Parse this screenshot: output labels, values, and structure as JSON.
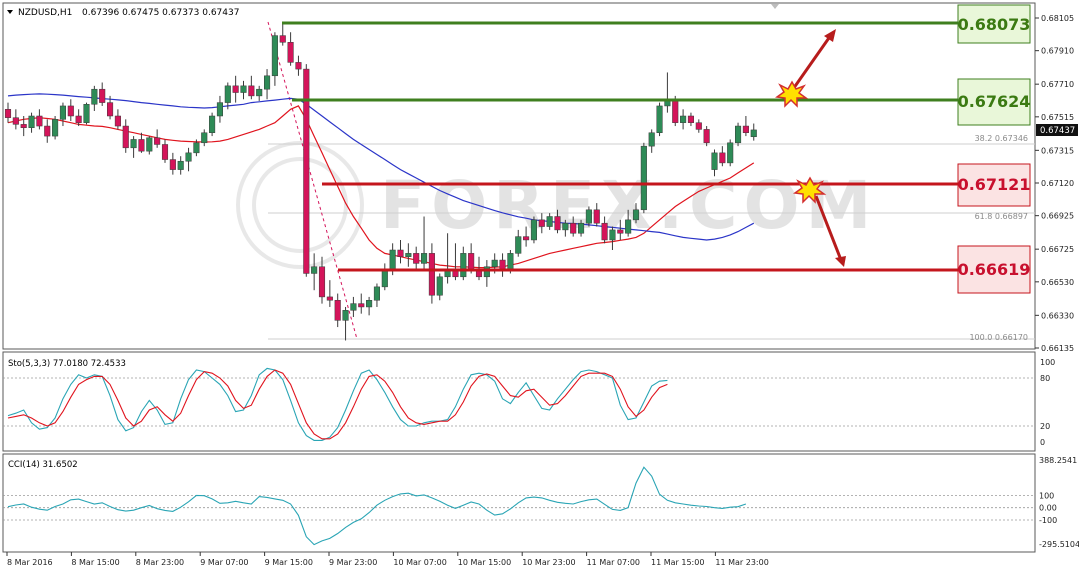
{
  "header": {
    "symbol": "NZDUSD,H1",
    "ohlc": "0.67396 0.67475 0.67373 0.67437"
  },
  "price_axis": {
    "ticks": [
      "0.68105",
      "0.67910",
      "0.67710",
      "0.67515",
      "0.67315",
      "0.67120",
      "0.66925",
      "0.66725",
      "0.66530",
      "0.66330",
      "0.66135"
    ],
    "current_price": "0.67437"
  },
  "fib_labels": [
    "38.2 0.67346",
    "61.8 0.66897",
    "100.0 0.66170"
  ],
  "levels": [
    {
      "value": "0.68073",
      "color": "#3f7f1f",
      "bg": "#e9f7d9",
      "text_color": "#3b7a12"
    },
    {
      "value": "0.67624",
      "color": "#3f7f1f",
      "bg": "#e9f7d9",
      "text_color": "#3b7a12"
    },
    {
      "value": "0.67121",
      "color": "#c4161c",
      "bg": "#fbe3e3",
      "text_color": "#c8102e"
    },
    {
      "value": "0.66619",
      "color": "#c4161c",
      "bg": "#fbe3e3",
      "text_color": "#c8102e"
    }
  ],
  "stochastic": {
    "label": "Sto(5,3,3) 77.0180 72.4533",
    "ticks": [
      "100",
      "80",
      "20",
      "0"
    ]
  },
  "cci": {
    "label": "CCI(14) 31.6502",
    "ticks": [
      "388.2541",
      "100",
      "0.00",
      "-100",
      "-295.5104"
    ]
  },
  "time_labels": [
    "8 Mar 2016",
    "8 Mar 15:00",
    "8 Mar 23:00",
    "9 Mar 07:00",
    "9 Mar 15:00",
    "9 Mar 23:00",
    "10 Mar 07:00",
    "10 Mar 15:00",
    "10 Mar 23:00",
    "11 Mar 07:00",
    "11 Mar 15:00",
    "11 Mar 23:00"
  ],
  "watermark": "FOREX.COM",
  "colors": {
    "bull": "#2e8b57",
    "bear": "#d4145a",
    "ma_fast": "#e0141e",
    "ma_slow": "#2b35c8",
    "stoch_main": "#2aa5b5",
    "stoch_signal": "#e0141e",
    "cci": "#2aa5b5",
    "arrow": "#b71c1c"
  },
  "chart_data": {
    "type": "candlestick",
    "timeframe": "H1",
    "candles": [
      [
        0.6756,
        0.676,
        0.6748,
        0.6751
      ],
      [
        0.6751,
        0.6756,
        0.6744,
        0.6747
      ],
      [
        0.6747,
        0.6752,
        0.674,
        0.6745
      ],
      [
        0.6745,
        0.6754,
        0.6742,
        0.6752
      ],
      [
        0.6752,
        0.6756,
        0.6744,
        0.6746
      ],
      [
        0.6746,
        0.675,
        0.6736,
        0.674
      ],
      [
        0.674,
        0.6752,
        0.6738,
        0.675
      ],
      [
        0.675,
        0.676,
        0.6746,
        0.6758
      ],
      [
        0.6758,
        0.6762,
        0.6749,
        0.6752
      ],
      [
        0.6752,
        0.6756,
        0.6746,
        0.6748
      ],
      [
        0.6748,
        0.676,
        0.6747,
        0.6759
      ],
      [
        0.6759,
        0.677,
        0.6755,
        0.6768
      ],
      [
        0.6768,
        0.6772,
        0.6758,
        0.676
      ],
      [
        0.676,
        0.6764,
        0.675,
        0.6752
      ],
      [
        0.6752,
        0.6756,
        0.6744,
        0.6746
      ],
      [
        0.6746,
        0.675,
        0.673,
        0.6733
      ],
      [
        0.6733,
        0.674,
        0.6727,
        0.6738
      ],
      [
        0.6738,
        0.6742,
        0.673,
        0.6731
      ],
      [
        0.6731,
        0.674,
        0.6729,
        0.6739
      ],
      [
        0.6739,
        0.6744,
        0.6733,
        0.6735
      ],
      [
        0.6735,
        0.6738,
        0.6724,
        0.6726
      ],
      [
        0.6726,
        0.673,
        0.6717,
        0.672
      ],
      [
        0.672,
        0.6728,
        0.6717,
        0.6725
      ],
      [
        0.6725,
        0.6733,
        0.6719,
        0.673
      ],
      [
        0.673,
        0.6738,
        0.6728,
        0.6736
      ],
      [
        0.6736,
        0.6744,
        0.6734,
        0.6742
      ],
      [
        0.6742,
        0.6754,
        0.674,
        0.6752
      ],
      [
        0.6752,
        0.6764,
        0.6748,
        0.676
      ],
      [
        0.676,
        0.6772,
        0.6756,
        0.677
      ],
      [
        0.677,
        0.6776,
        0.676,
        0.6766
      ],
      [
        0.6766,
        0.6773,
        0.6762,
        0.677
      ],
      [
        0.677,
        0.6776,
        0.6762,
        0.6764
      ],
      [
        0.6764,
        0.677,
        0.6761,
        0.6768
      ],
      [
        0.6768,
        0.678,
        0.6762,
        0.6776
      ],
      [
        0.6776,
        0.6802,
        0.677,
        0.68
      ],
      [
        0.68,
        0.6808,
        0.6794,
        0.6796
      ],
      [
        0.6796,
        0.6802,
        0.6782,
        0.6784
      ],
      [
        0.6784,
        0.6788,
        0.6776,
        0.678
      ],
      [
        0.678,
        0.6783,
        0.6656,
        0.6658
      ],
      [
        0.6658,
        0.667,
        0.6648,
        0.6662
      ],
      [
        0.6662,
        0.6668,
        0.664,
        0.6644
      ],
      [
        0.6644,
        0.6654,
        0.6638,
        0.6642
      ],
      [
        0.6642,
        0.6646,
        0.6626,
        0.663
      ],
      [
        0.663,
        0.6638,
        0.6618,
        0.6636
      ],
      [
        0.6636,
        0.6644,
        0.6632,
        0.664
      ],
      [
        0.664,
        0.6646,
        0.6634,
        0.6638
      ],
      [
        0.6638,
        0.6644,
        0.6633,
        0.6642
      ],
      [
        0.6642,
        0.6652,
        0.6638,
        0.665
      ],
      [
        0.665,
        0.6664,
        0.6648,
        0.666
      ],
      [
        0.666,
        0.6676,
        0.6657,
        0.6672
      ],
      [
        0.6672,
        0.6678,
        0.6664,
        0.6668
      ],
      [
        0.6668,
        0.6676,
        0.6662,
        0.667
      ],
      [
        0.667,
        0.6674,
        0.666,
        0.6664
      ],
      [
        0.6664,
        0.6692,
        0.666,
        0.667
      ],
      [
        0.667,
        0.6676,
        0.664,
        0.6645
      ],
      [
        0.6645,
        0.6658,
        0.6642,
        0.6656
      ],
      [
        0.6656,
        0.6682,
        0.6652,
        0.666
      ],
      [
        0.666,
        0.6676,
        0.6654,
        0.6656
      ],
      [
        0.6656,
        0.6674,
        0.6654,
        0.667
      ],
      [
        0.667,
        0.6676,
        0.6658,
        0.666
      ],
      [
        0.666,
        0.6668,
        0.6654,
        0.6656
      ],
      [
        0.6656,
        0.6666,
        0.665,
        0.6662
      ],
      [
        0.6662,
        0.667,
        0.6658,
        0.6666
      ],
      [
        0.6666,
        0.667,
        0.6656,
        0.666
      ],
      [
        0.666,
        0.6672,
        0.6658,
        0.667
      ],
      [
        0.667,
        0.6684,
        0.6668,
        0.668
      ],
      [
        0.668,
        0.6686,
        0.6674,
        0.6678
      ],
      [
        0.6678,
        0.6692,
        0.6676,
        0.669
      ],
      [
        0.669,
        0.6694,
        0.6682,
        0.6686
      ],
      [
        0.6686,
        0.6694,
        0.6684,
        0.6692
      ],
      [
        0.6692,
        0.6696,
        0.6682,
        0.6684
      ],
      [
        0.6684,
        0.669,
        0.668,
        0.6688
      ],
      [
        0.6688,
        0.6692,
        0.668,
        0.6682
      ],
      [
        0.6682,
        0.669,
        0.668,
        0.6688
      ],
      [
        0.6688,
        0.6698,
        0.6686,
        0.6696
      ],
      [
        0.6696,
        0.67,
        0.6686,
        0.6688
      ],
      [
        0.6688,
        0.6692,
        0.6676,
        0.6678
      ],
      [
        0.6678,
        0.6686,
        0.6672,
        0.6684
      ],
      [
        0.6684,
        0.669,
        0.6678,
        0.6682
      ],
      [
        0.6682,
        0.6696,
        0.668,
        0.669
      ],
      [
        0.669,
        0.67,
        0.6688,
        0.6696
      ],
      [
        0.6696,
        0.6736,
        0.6694,
        0.6734
      ],
      [
        0.6734,
        0.6744,
        0.673,
        0.6742
      ],
      [
        0.6742,
        0.676,
        0.674,
        0.6758
      ],
      [
        0.6758,
        0.6778,
        0.6754,
        0.6762
      ],
      [
        0.6762,
        0.6764,
        0.6746,
        0.6748
      ],
      [
        0.6748,
        0.6756,
        0.6744,
        0.6752
      ],
      [
        0.6752,
        0.6754,
        0.6746,
        0.6748
      ],
      [
        0.6748,
        0.675,
        0.6742,
        0.6744
      ],
      [
        0.6744,
        0.6746,
        0.6734,
        0.6736
      ],
      [
        0.672,
        0.6732,
        0.6716,
        0.673
      ],
      [
        0.673,
        0.6734,
        0.6722,
        0.6724
      ],
      [
        0.6724,
        0.6738,
        0.6722,
        0.6736
      ],
      [
        0.6736,
        0.6748,
        0.6734,
        0.6746
      ],
      [
        0.6746,
        0.6752,
        0.674,
        0.6742
      ],
      [
        0.67396,
        0.67475,
        0.67373,
        0.67437
      ]
    ],
    "ma_fast": [
      0.6748,
      0.6749,
      0.675,
      0.67505,
      0.6751,
      0.67505,
      0.675,
      0.6749,
      0.6748,
      0.6747,
      0.67465,
      0.6746,
      0.67458,
      0.6745,
      0.6744,
      0.6743,
      0.6742,
      0.6741,
      0.674,
      0.6739,
      0.6738,
      0.67375,
      0.6737,
      0.67368,
      0.67366,
      0.67365,
      0.67366,
      0.6737,
      0.6738,
      0.67395,
      0.6741,
      0.67425,
      0.6744,
      0.6746,
      0.6748,
      0.6752,
      0.6756,
      0.6758,
      0.675,
      0.674,
      0.673,
      0.672,
      0.671,
      0.67,
      0.6692,
      0.6685,
      0.6678,
      0.6673,
      0.667,
      0.6669,
      0.6668,
      0.6667,
      0.6666,
      0.6665,
      0.6664,
      0.6663,
      0.66625,
      0.6662,
      0.6662,
      0.66618,
      0.66615,
      0.66615,
      0.66618,
      0.6662,
      0.6663,
      0.6664,
      0.66655,
      0.6667,
      0.66685,
      0.667,
      0.6671,
      0.6672,
      0.6673,
      0.6674,
      0.6675,
      0.6676,
      0.66765,
      0.6677,
      0.66778,
      0.66785,
      0.66795,
      0.6682,
      0.6686,
      0.669,
      0.6694,
      0.6698,
      0.6701,
      0.6704,
      0.6707,
      0.6709,
      0.6711,
      0.6713,
      0.6715,
      0.6718,
      0.6721,
      0.6724
    ],
    "ma_slow": [
      0.6764,
      0.67645,
      0.67648,
      0.6765,
      0.67652,
      0.6765,
      0.67648,
      0.67645,
      0.6764,
      0.67636,
      0.67632,
      0.67628,
      0.67624,
      0.6762,
      0.67616,
      0.67612,
      0.67606,
      0.676,
      0.67595,
      0.6759,
      0.67585,
      0.6758,
      0.67575,
      0.67572,
      0.6757,
      0.67568,
      0.6757,
      0.67575,
      0.6758,
      0.67585,
      0.6759,
      0.676,
      0.67605,
      0.6761,
      0.67615,
      0.6762,
      0.67625,
      0.6762,
      0.6759,
      0.67555,
      0.6752,
      0.67485,
      0.6745,
      0.67415,
      0.6738,
      0.6735,
      0.6732,
      0.6729,
      0.6726,
      0.6723,
      0.672,
      0.67175,
      0.6715,
      0.67125,
      0.671,
      0.67075,
      0.67055,
      0.67035,
      0.67015,
      0.67,
      0.66985,
      0.6697,
      0.66955,
      0.66942,
      0.6693,
      0.66918,
      0.6691,
      0.669,
      0.66895,
      0.6689,
      0.66885,
      0.6688,
      0.66878,
      0.66875,
      0.6687,
      0.66865,
      0.6686,
      0.66855,
      0.6685,
      0.66845,
      0.6684,
      0.66835,
      0.6683,
      0.66825,
      0.66815,
      0.66805,
      0.66795,
      0.6679,
      0.66785,
      0.6678,
      0.66785,
      0.66795,
      0.6681,
      0.6683,
      0.66855,
      0.6688
    ],
    "stochastic": {
      "main": [
        33,
        36,
        40,
        24,
        16,
        18,
        30,
        54,
        72,
        84,
        80,
        84,
        82,
        58,
        28,
        14,
        18,
        38,
        52,
        40,
        22,
        24,
        54,
        78,
        90,
        88,
        80,
        72,
        58,
        38,
        40,
        58,
        84,
        92,
        90,
        78,
        52,
        24,
        8,
        2,
        2,
        6,
        18,
        40,
        64,
        86,
        90,
        78,
        62,
        44,
        28,
        20,
        20,
        24,
        26,
        26,
        28,
        44,
        66,
        84,
        86,
        84,
        76,
        54,
        48,
        62,
        74,
        58,
        42,
        40,
        54,
        66,
        78,
        88,
        90,
        88,
        84,
        80,
        46,
        28,
        30,
        50,
        70,
        76,
        77
      ],
      "signal": [
        30,
        32,
        34,
        30,
        24,
        20,
        24,
        38,
        56,
        72,
        78,
        82,
        82,
        72,
        52,
        30,
        20,
        26,
        40,
        44,
        34,
        26,
        36,
        58,
        78,
        88,
        86,
        80,
        70,
        52,
        42,
        46,
        66,
        82,
        90,
        86,
        72,
        48,
        24,
        10,
        4,
        4,
        10,
        24,
        44,
        66,
        82,
        84,
        76,
        62,
        44,
        30,
        24,
        22,
        24,
        26,
        26,
        34,
        50,
        70,
        82,
        85,
        82,
        70,
        58,
        56,
        64,
        66,
        56,
        46,
        48,
        58,
        70,
        82,
        86,
        86,
        86,
        82,
        66,
        44,
        32,
        40,
        56,
        68,
        72
      ]
    },
    "cci": [
      8,
      22,
      30,
      4,
      -12,
      -20,
      10,
      30,
      64,
      70,
      50,
      30,
      40,
      10,
      -16,
      -28,
      -20,
      0,
      18,
      -8,
      -22,
      -30,
      4,
      48,
      100,
      98,
      72,
      36,
      40,
      52,
      40,
      30,
      90,
      84,
      72,
      60,
      30,
      -62,
      -236,
      -300,
      -270,
      -250,
      -210,
      -160,
      -120,
      -90,
      -40,
      20,
      60,
      90,
      112,
      118,
      96,
      104,
      80,
      52,
      20,
      -6,
      20,
      46,
      30,
      -20,
      -60,
      -50,
      -10,
      40,
      80,
      86,
      80,
      60,
      44,
      36,
      30,
      50,
      64,
      70,
      28,
      -14,
      -22,
      0,
      200,
      330,
      256,
      110,
      60,
      40,
      30,
      20,
      14,
      10,
      0,
      -6,
      4,
      8,
      30
    ]
  }
}
